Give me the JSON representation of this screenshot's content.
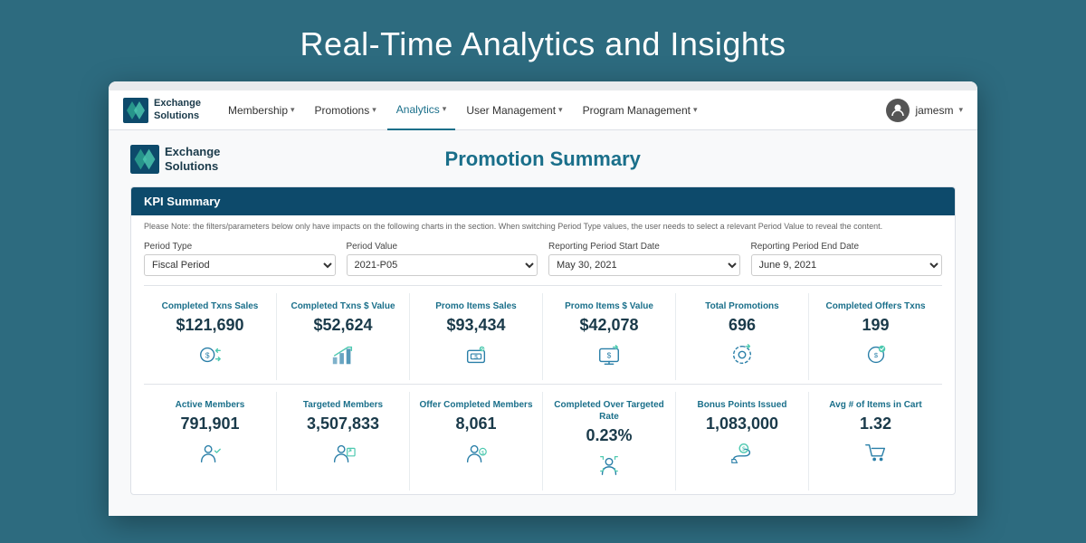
{
  "hero": {
    "title": "Real-Time Analytics and Insights"
  },
  "navbar": {
    "brand": "Exchange Solutions",
    "brand_line1": "Exchange",
    "brand_line2": "Solutions",
    "nav_items": [
      {
        "label": "Membership",
        "has_dropdown": true
      },
      {
        "label": "Promotions",
        "has_dropdown": true
      },
      {
        "label": "Analytics",
        "has_dropdown": true,
        "active": true
      },
      {
        "label": "User Management",
        "has_dropdown": true
      },
      {
        "label": "Program Management",
        "has_dropdown": true
      }
    ],
    "user": {
      "name": "jamesm"
    }
  },
  "report": {
    "brand_line1": "Exchange",
    "brand_line2": "Solutions",
    "title": "Promotion Summary"
  },
  "kpi_section": {
    "header": "KPI Summary",
    "note": "Please Note: the filters/parameters below only have impacts on the following charts in the section. When switching Period Type values, the user needs to select a relevant Period Value to reveal the content.",
    "filters": [
      {
        "label": "Period Type",
        "value": "Fiscal Period"
      },
      {
        "label": "Period Value",
        "value": "2021-P05"
      },
      {
        "label": "Reporting Period Start Date",
        "value": "May 30, 2021"
      },
      {
        "label": "Reporting Period End Date",
        "value": "June 9, 2021"
      }
    ],
    "kpi_row1": [
      {
        "label": "Completed Txns Sales",
        "value": "$121,690",
        "icon": "money-transfer"
      },
      {
        "label": "Completed Txns $ Value",
        "value": "$52,624",
        "icon": "trending-up"
      },
      {
        "label": "Promo Items Sales",
        "value": "$93,434",
        "icon": "cash-register"
      },
      {
        "label": "Promo Items $ Value",
        "value": "$42,078",
        "icon": "monitor-dollar"
      },
      {
        "label": "Total Promotions",
        "value": "696",
        "icon": "settings-up"
      },
      {
        "label": "Completed Offers Txns",
        "value": "199",
        "icon": "offer-complete"
      }
    ],
    "kpi_row2": [
      {
        "label": "Active Members",
        "value": "791,901",
        "icon": "person-check"
      },
      {
        "label": "Targeted Members",
        "value": "3,507,833",
        "icon": "person-target"
      },
      {
        "label": "Offer Completed Members",
        "value": "8,061",
        "icon": "person-offer"
      },
      {
        "label": "Completed Over Targeted Rate",
        "value": "0.23%",
        "icon": "person-scan"
      },
      {
        "label": "Bonus Points Issued",
        "value": "1,083,000",
        "icon": "hand-coins"
      },
      {
        "label": "Avg # of Items in Cart",
        "value": "1.32",
        "icon": "shopping-cart"
      }
    ]
  }
}
